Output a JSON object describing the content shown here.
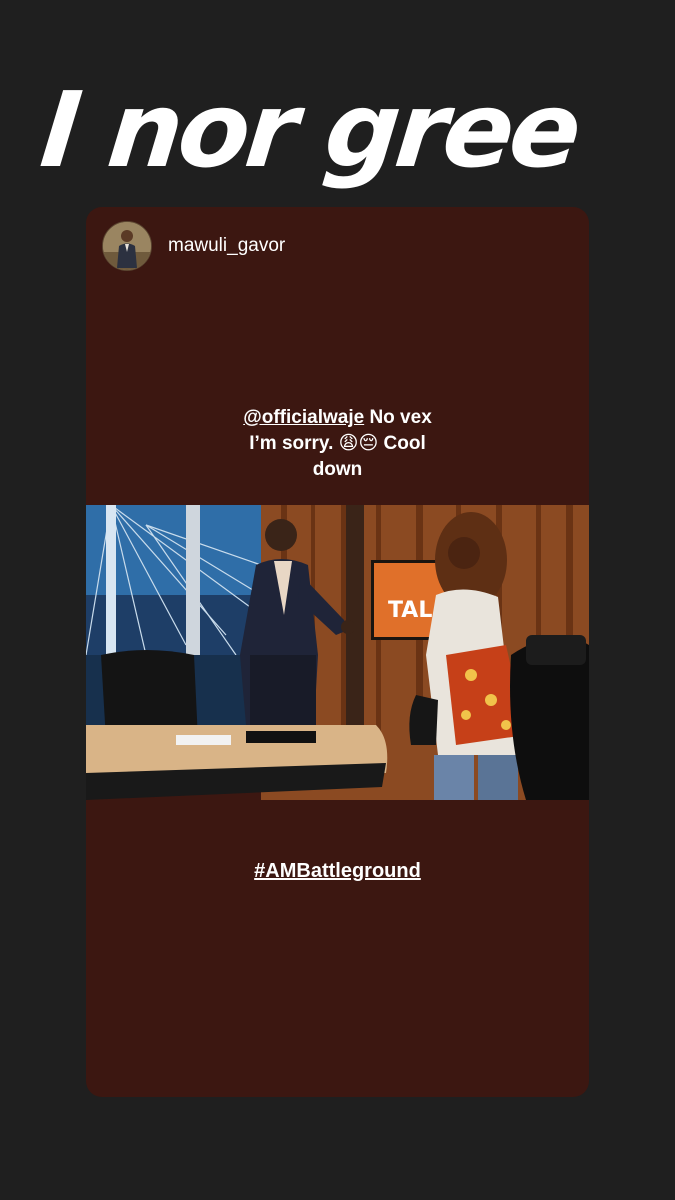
{
  "story": {
    "overlay_text": "I nor gree"
  },
  "post": {
    "username": "mawuli_gavor",
    "caption": {
      "mention": "@officialwaje",
      "line1_rest": " No vex",
      "line2": "I’m sorry. 😩😔 Cool",
      "line3": "down"
    },
    "hashtag": "#AMBattleground",
    "photo_sign_text": "TAL"
  },
  "colors": {
    "background": "#1f1f1f",
    "card": "#3c1711",
    "text": "#ffffff"
  }
}
